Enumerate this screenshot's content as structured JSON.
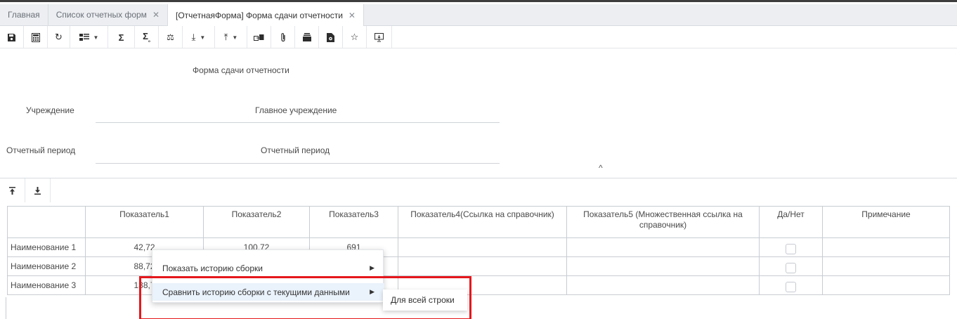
{
  "tabs": [
    {
      "label": "Главная",
      "closable": false,
      "active": false
    },
    {
      "label": "Список отчетных форм",
      "closable": true,
      "active": false
    },
    {
      "label": "[ОтчетнаяФорма] Форма сдачи отчетности",
      "closable": true,
      "active": true
    }
  ],
  "toolbar": {
    "icons": [
      "save-icon",
      "calculator-icon",
      "refresh-icon",
      "check-list-icon",
      "sum-icon",
      "sum-sub-icon",
      "balance-icon",
      "download-icon",
      "upload-icon",
      "transfer-icon",
      "attach-icon",
      "archive-icon",
      "history-icon",
      "star-icon",
      "present-icon"
    ]
  },
  "form": {
    "title": "Форма сдачи отчетности",
    "institution_label": "Учреждение",
    "institution_value": "Главное учреждение",
    "period_label": "Отчетный период",
    "period_value": "Отчетный период",
    "collapse_glyph": "^"
  },
  "table": {
    "headers": [
      "",
      "Показатель1",
      "Показатель2",
      "Показатель3",
      "Показатель4(Ссылка на справочник)",
      "Показатель5 (Множественная ссылка на справочник)",
      "Да/Нет",
      "Примечание"
    ],
    "rows": [
      {
        "name": "Наименование 1",
        "p1": "42,72",
        "p2": "100,72",
        "p3": "691",
        "p4": "",
        "p5": "",
        "yesno": false,
        "note": ""
      },
      {
        "name": "Наименование 2",
        "p1": "88,72",
        "p2": "",
        "p3": "",
        "p4": "",
        "p5": "",
        "yesno": false,
        "note": ""
      },
      {
        "name": "Наименование 3",
        "p1": "138,7",
        "p2": "",
        "p3": "",
        "p4": "",
        "p5": "",
        "yesno": false,
        "note": ""
      }
    ]
  },
  "context_menu": {
    "items": [
      {
        "label": "Показать историю сборки",
        "has_submenu": true
      },
      {
        "label": "Сравнить историю сборки с текущими данными",
        "has_submenu": true,
        "highlighted": true
      }
    ],
    "submenu": {
      "label": "Для всей строки"
    }
  },
  "colors": {
    "highlight_box": "#e5171c",
    "hover": "#eaf2fb",
    "tab_bar": "#eceef1"
  }
}
